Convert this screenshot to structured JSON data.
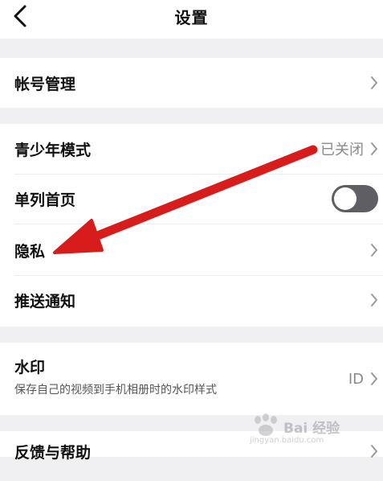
{
  "header": {
    "title": "设置",
    "back_icon": "chevron-left-icon"
  },
  "account": {
    "label": "帐号管理"
  },
  "teen_mode": {
    "label": "青少年模式",
    "value": "已关闭"
  },
  "single_column": {
    "label": "单列首页",
    "toggle_on": false
  },
  "privacy": {
    "label": "隐私"
  },
  "push": {
    "label": "推送通知"
  },
  "watermark_setting": {
    "label": "水印",
    "description": "保存自己的视频到手机相册时的水印样式",
    "value": "ID"
  },
  "feedback": {
    "label": "反馈与帮助"
  },
  "overlay": {
    "annotation_arrow_color": "#d81c1c"
  },
  "site_watermark": {
    "brand": "Bai 经验",
    "url": "jingyan.baidu.com"
  }
}
